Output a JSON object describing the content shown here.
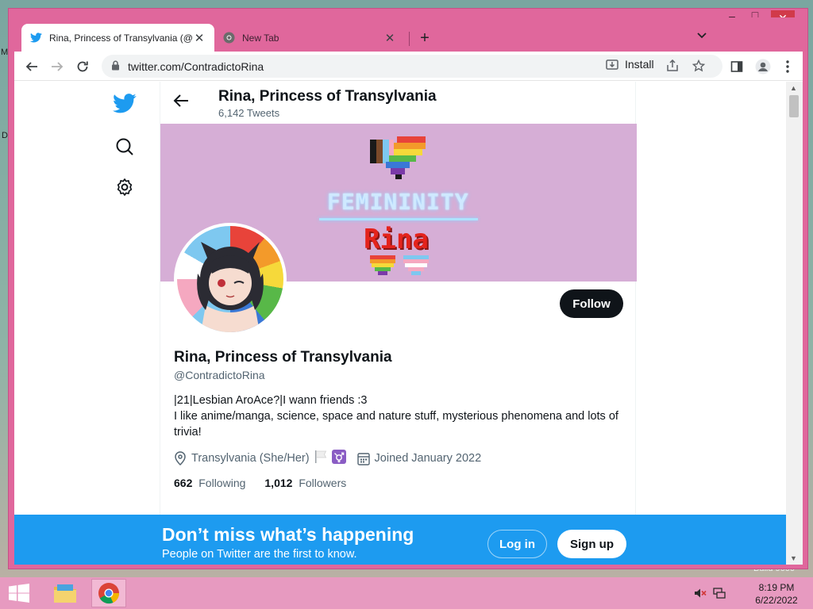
{
  "browser": {
    "tabs": [
      {
        "title": "Rina, Princess of Transylvania (@",
        "favicon": "twitter-bird-icon",
        "active": true
      },
      {
        "title": "New Tab",
        "favicon": "chrome-icon",
        "active": false
      }
    ],
    "url": "twitter.com/ContradictoRina",
    "install_label": "Install",
    "window_colors": {
      "frame": "#e0679c",
      "close": "#d13a4a"
    }
  },
  "desktop": {
    "left_fragments": [
      "M",
      "D"
    ],
    "right_fragment": "Build 9600"
  },
  "header": {
    "name": "Rina, Princess of Transylvania",
    "tweet_count": "6,142 Tweets"
  },
  "banner": {
    "word": "FEMININITY",
    "name": "Rina"
  },
  "profile": {
    "name": "Rina, Princess of Transylvania",
    "handle": "@ContradictoRina",
    "bio_line1": "|21|Lesbian AroAce?|I wann friends :3",
    "bio_line2": "I like anime/manga, science, space and nature stuff, mysterious phenomena and lots of trivia!",
    "location": "Transylvania (She/Her)",
    "joined": "Joined January 2022",
    "following_count": "662",
    "following_label": "Following",
    "followers_count": "1,012",
    "followers_label": "Followers",
    "follow_button": "Follow"
  },
  "bottom_bar": {
    "title": "Don’t miss what’s happening",
    "subtitle": "People on Twitter are the first to know.",
    "login": "Log in",
    "signup": "Sign up"
  },
  "taskbar": {
    "time": "8:19 PM",
    "date": "6/22/2022"
  },
  "colors": {
    "twitter_blue": "#1d9bf0",
    "text_primary": "#0f1419",
    "text_secondary": "#536471"
  }
}
